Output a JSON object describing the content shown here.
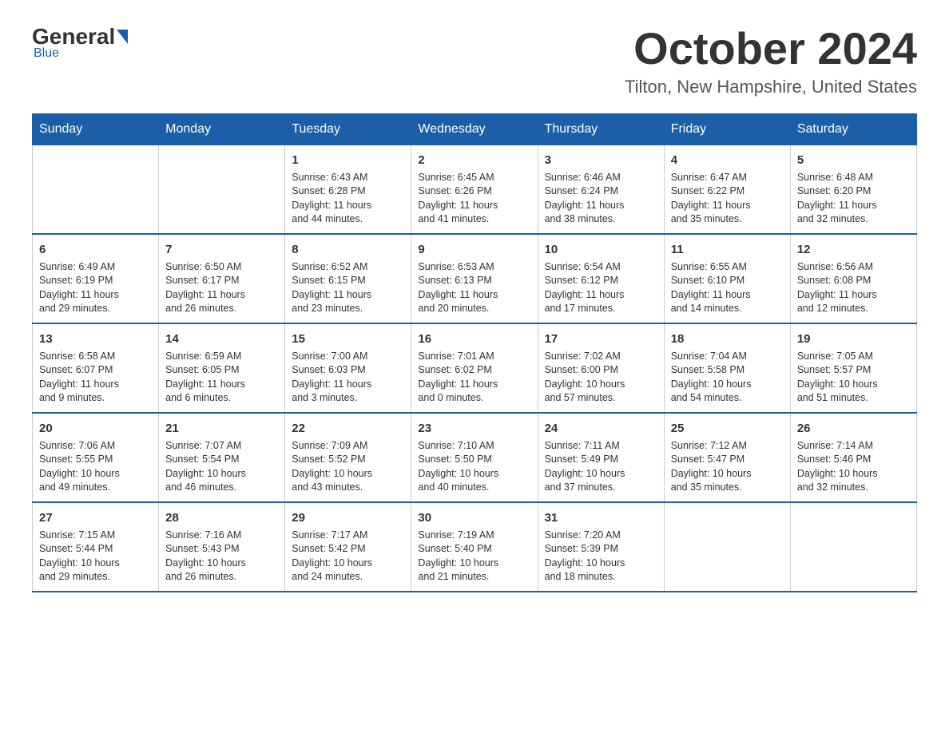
{
  "logo": {
    "general": "General",
    "blue": "Blue"
  },
  "title": "October 2024",
  "location": "Tilton, New Hampshire, United States",
  "weekdays": [
    "Sunday",
    "Monday",
    "Tuesday",
    "Wednesday",
    "Thursday",
    "Friday",
    "Saturday"
  ],
  "weeks": [
    [
      {
        "day": "",
        "info": ""
      },
      {
        "day": "",
        "info": ""
      },
      {
        "day": "1",
        "info": "Sunrise: 6:43 AM\nSunset: 6:28 PM\nDaylight: 11 hours\nand 44 minutes."
      },
      {
        "day": "2",
        "info": "Sunrise: 6:45 AM\nSunset: 6:26 PM\nDaylight: 11 hours\nand 41 minutes."
      },
      {
        "day": "3",
        "info": "Sunrise: 6:46 AM\nSunset: 6:24 PM\nDaylight: 11 hours\nand 38 minutes."
      },
      {
        "day": "4",
        "info": "Sunrise: 6:47 AM\nSunset: 6:22 PM\nDaylight: 11 hours\nand 35 minutes."
      },
      {
        "day": "5",
        "info": "Sunrise: 6:48 AM\nSunset: 6:20 PM\nDaylight: 11 hours\nand 32 minutes."
      }
    ],
    [
      {
        "day": "6",
        "info": "Sunrise: 6:49 AM\nSunset: 6:19 PM\nDaylight: 11 hours\nand 29 minutes."
      },
      {
        "day": "7",
        "info": "Sunrise: 6:50 AM\nSunset: 6:17 PM\nDaylight: 11 hours\nand 26 minutes."
      },
      {
        "day": "8",
        "info": "Sunrise: 6:52 AM\nSunset: 6:15 PM\nDaylight: 11 hours\nand 23 minutes."
      },
      {
        "day": "9",
        "info": "Sunrise: 6:53 AM\nSunset: 6:13 PM\nDaylight: 11 hours\nand 20 minutes."
      },
      {
        "day": "10",
        "info": "Sunrise: 6:54 AM\nSunset: 6:12 PM\nDaylight: 11 hours\nand 17 minutes."
      },
      {
        "day": "11",
        "info": "Sunrise: 6:55 AM\nSunset: 6:10 PM\nDaylight: 11 hours\nand 14 minutes."
      },
      {
        "day": "12",
        "info": "Sunrise: 6:56 AM\nSunset: 6:08 PM\nDaylight: 11 hours\nand 12 minutes."
      }
    ],
    [
      {
        "day": "13",
        "info": "Sunrise: 6:58 AM\nSunset: 6:07 PM\nDaylight: 11 hours\nand 9 minutes."
      },
      {
        "day": "14",
        "info": "Sunrise: 6:59 AM\nSunset: 6:05 PM\nDaylight: 11 hours\nand 6 minutes."
      },
      {
        "day": "15",
        "info": "Sunrise: 7:00 AM\nSunset: 6:03 PM\nDaylight: 11 hours\nand 3 minutes."
      },
      {
        "day": "16",
        "info": "Sunrise: 7:01 AM\nSunset: 6:02 PM\nDaylight: 11 hours\nand 0 minutes."
      },
      {
        "day": "17",
        "info": "Sunrise: 7:02 AM\nSunset: 6:00 PM\nDaylight: 10 hours\nand 57 minutes."
      },
      {
        "day": "18",
        "info": "Sunrise: 7:04 AM\nSunset: 5:58 PM\nDaylight: 10 hours\nand 54 minutes."
      },
      {
        "day": "19",
        "info": "Sunrise: 7:05 AM\nSunset: 5:57 PM\nDaylight: 10 hours\nand 51 minutes."
      }
    ],
    [
      {
        "day": "20",
        "info": "Sunrise: 7:06 AM\nSunset: 5:55 PM\nDaylight: 10 hours\nand 49 minutes."
      },
      {
        "day": "21",
        "info": "Sunrise: 7:07 AM\nSunset: 5:54 PM\nDaylight: 10 hours\nand 46 minutes."
      },
      {
        "day": "22",
        "info": "Sunrise: 7:09 AM\nSunset: 5:52 PM\nDaylight: 10 hours\nand 43 minutes."
      },
      {
        "day": "23",
        "info": "Sunrise: 7:10 AM\nSunset: 5:50 PM\nDaylight: 10 hours\nand 40 minutes."
      },
      {
        "day": "24",
        "info": "Sunrise: 7:11 AM\nSunset: 5:49 PM\nDaylight: 10 hours\nand 37 minutes."
      },
      {
        "day": "25",
        "info": "Sunrise: 7:12 AM\nSunset: 5:47 PM\nDaylight: 10 hours\nand 35 minutes."
      },
      {
        "day": "26",
        "info": "Sunrise: 7:14 AM\nSunset: 5:46 PM\nDaylight: 10 hours\nand 32 minutes."
      }
    ],
    [
      {
        "day": "27",
        "info": "Sunrise: 7:15 AM\nSunset: 5:44 PM\nDaylight: 10 hours\nand 29 minutes."
      },
      {
        "day": "28",
        "info": "Sunrise: 7:16 AM\nSunset: 5:43 PM\nDaylight: 10 hours\nand 26 minutes."
      },
      {
        "day": "29",
        "info": "Sunrise: 7:17 AM\nSunset: 5:42 PM\nDaylight: 10 hours\nand 24 minutes."
      },
      {
        "day": "30",
        "info": "Sunrise: 7:19 AM\nSunset: 5:40 PM\nDaylight: 10 hours\nand 21 minutes."
      },
      {
        "day": "31",
        "info": "Sunrise: 7:20 AM\nSunset: 5:39 PM\nDaylight: 10 hours\nand 18 minutes."
      },
      {
        "day": "",
        "info": ""
      },
      {
        "day": "",
        "info": ""
      }
    ]
  ]
}
